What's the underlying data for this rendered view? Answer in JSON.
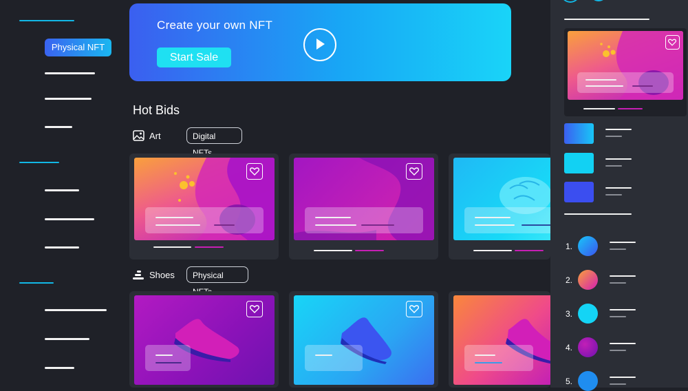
{
  "sidebar": {
    "active_item": "Physical NFT"
  },
  "banner": {
    "title": "Create your own NFT",
    "cta": "Start Sale"
  },
  "hot_bids": {
    "heading": "Hot Bids",
    "sections": [
      {
        "label": "Art",
        "chip": "Digital NFTs"
      },
      {
        "label": "Shoes",
        "chip": "Physical NFTs"
      }
    ]
  },
  "right_panel": {
    "ranks": [
      "1.",
      "2.",
      "3.",
      "4.",
      "5."
    ]
  },
  "colors": {
    "background": "#1f2128",
    "panel": "#2b2e36",
    "accent_cyan": "#12b8e6",
    "accent_blue": "#3b5ff0",
    "accent_magenta": "#c71fb4"
  }
}
